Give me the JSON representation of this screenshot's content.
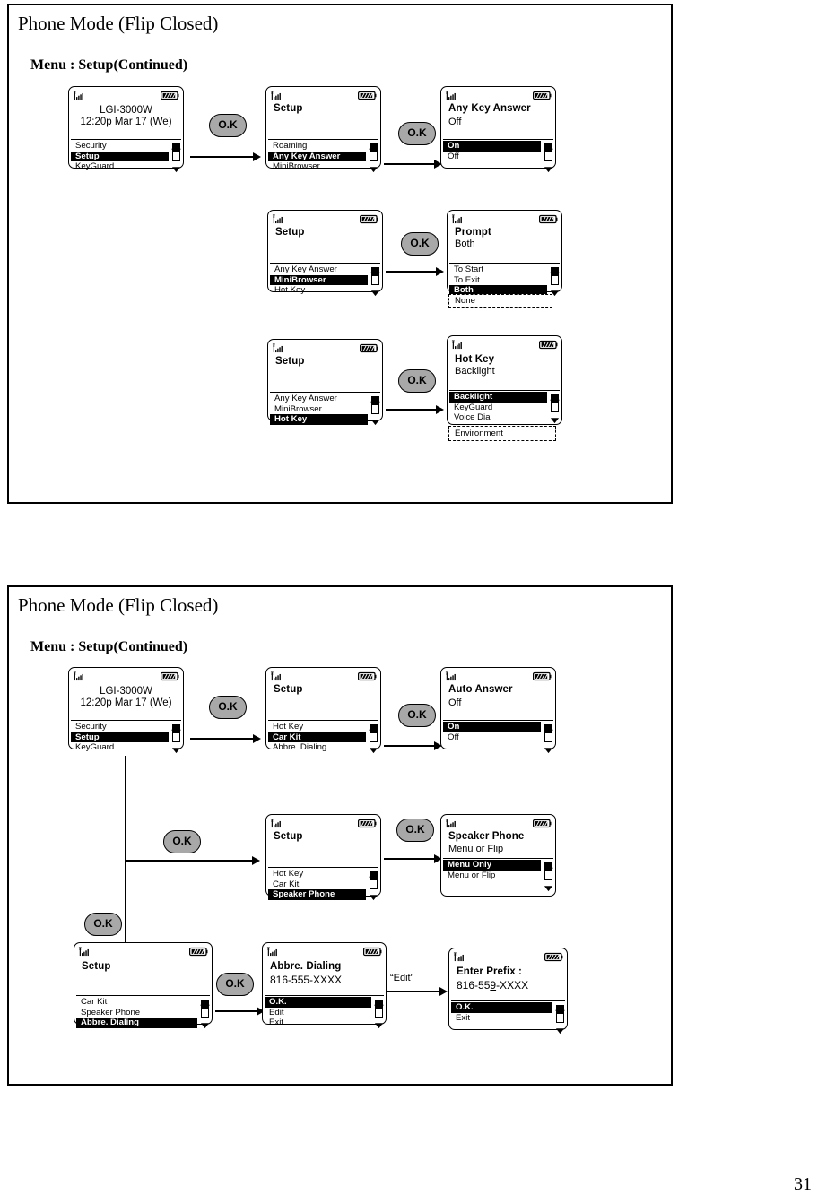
{
  "page": {
    "number": "31"
  },
  "panels": [
    {
      "title": "Phone Mode (Flip Closed)",
      "subtitle": "Menu : Setup(Continued)"
    },
    {
      "title": "Phone Mode (Flip Closed)",
      "subtitle": "Menu : Setup(Continued)"
    }
  ],
  "icons": {
    "signal": "signal-bars-icon",
    "battery": "battery-icon",
    "scroll_up": "scroll-up-icon",
    "scroll_down": "scroll-down-icon"
  },
  "buttons": {
    "ok": "O.K"
  },
  "edge_labels": {
    "edit": "“Edit”"
  },
  "screens": {
    "idle_1": {
      "name": "idle-screen",
      "line1": "LGI-3000W",
      "line2": "12:20p Mar 17 (We)",
      "items": [
        {
          "label": "Security",
          "selected": false
        },
        {
          "label": "Setup",
          "selected": true
        },
        {
          "label": "KeyGuard",
          "selected": false
        }
      ]
    },
    "setup_any_key": {
      "name": "setup-menu",
      "title": "Setup",
      "items": [
        {
          "label": "Roaming",
          "selected": false
        },
        {
          "label": "Any Key Answer",
          "selected": true
        },
        {
          "label": "MiniBrowser",
          "selected": false
        }
      ]
    },
    "any_key_answer": {
      "name": "any-key-answer-screen",
      "title": "Any Key Answer",
      "value": "Off",
      "items": [
        {
          "label": "On",
          "selected": true
        },
        {
          "label": "Off",
          "selected": false
        }
      ]
    },
    "setup_minibrowser": {
      "name": "setup-menu",
      "title": "Setup",
      "items": [
        {
          "label": "Any Key Answer",
          "selected": false
        },
        {
          "label": "MiniBrowser",
          "selected": true
        },
        {
          "label": "Hot Key",
          "selected": false
        }
      ]
    },
    "prompt": {
      "name": "prompt-screen",
      "title": "Prompt",
      "value": "Both",
      "items": [
        {
          "label": "To Start",
          "selected": false
        },
        {
          "label": "To Exit",
          "selected": false
        },
        {
          "label": "Both",
          "selected": true
        }
      ],
      "overflow": [
        {
          "label": "None",
          "selected": false
        }
      ]
    },
    "setup_hotkey": {
      "name": "setup-menu",
      "title": "Setup",
      "items": [
        {
          "label": "Any Key Answer",
          "selected": false
        },
        {
          "label": "MiniBrowser",
          "selected": false
        },
        {
          "label": "Hot Key",
          "selected": true
        }
      ]
    },
    "hot_key": {
      "name": "hot-key-screen",
      "title": "Hot Key",
      "value": "Backlight",
      "items": [
        {
          "label": "Backlight",
          "selected": true
        },
        {
          "label": "KeyGuard",
          "selected": false
        },
        {
          "label": "Voice Dial",
          "selected": false
        }
      ],
      "overflow": [
        {
          "label": "Environment",
          "selected": false
        }
      ]
    },
    "idle_2": {
      "name": "idle-screen",
      "line1": "LGI-3000W",
      "line2": "12:20p Mar 17 (We)",
      "items": [
        {
          "label": "Security",
          "selected": false
        },
        {
          "label": "Setup",
          "selected": true
        },
        {
          "label": "KeyGuard",
          "selected": false
        }
      ]
    },
    "setup_carkit": {
      "name": "setup-menu",
      "title": "Setup",
      "items": [
        {
          "label": "Hot Key",
          "selected": false
        },
        {
          "label": "Car Kit",
          "selected": true
        },
        {
          "label": "Abbre. Dialing",
          "selected": false
        }
      ]
    },
    "auto_answer": {
      "name": "auto-answer-screen",
      "title": "Auto Answer",
      "value": "Off",
      "items": [
        {
          "label": "On",
          "selected": true
        },
        {
          "label": "Off",
          "selected": false
        }
      ]
    },
    "setup_speaker": {
      "name": "setup-menu",
      "title": "Setup",
      "items": [
        {
          "label": "Hot Key",
          "selected": false
        },
        {
          "label": "Car Kit",
          "selected": false
        },
        {
          "label": "Speaker Phone",
          "selected": true
        }
      ]
    },
    "speaker_phone": {
      "name": "speaker-phone-screen",
      "title": "Speaker Phone",
      "value": "Menu or Flip",
      "items": [
        {
          "label": "Menu Only",
          "selected": true
        },
        {
          "label": "Menu or Flip",
          "selected": false
        }
      ]
    },
    "setup_abbre": {
      "name": "setup-menu",
      "title": "Setup",
      "items": [
        {
          "label": "Car Kit",
          "selected": false
        },
        {
          "label": "Speaker Phone",
          "selected": false
        },
        {
          "label": "Abbre. Dialing",
          "selected": true
        }
      ]
    },
    "abbre_dialing": {
      "name": "abbre-dialing-screen",
      "title": "Abbre. Dialing",
      "value": "816-555-XXXX",
      "items": [
        {
          "label": "O.K.",
          "selected": true
        },
        {
          "label": "Edit",
          "selected": false
        },
        {
          "label": "Exit",
          "selected": false
        }
      ]
    },
    "enter_prefix": {
      "name": "enter-prefix-screen",
      "title": "Enter Prefix :",
      "value_pre": "816-55",
      "value_cursor": "9",
      "value_post": "-XXXX",
      "items": [
        {
          "label": "O.K.",
          "selected": true
        },
        {
          "label": "Exit",
          "selected": false
        }
      ]
    }
  }
}
